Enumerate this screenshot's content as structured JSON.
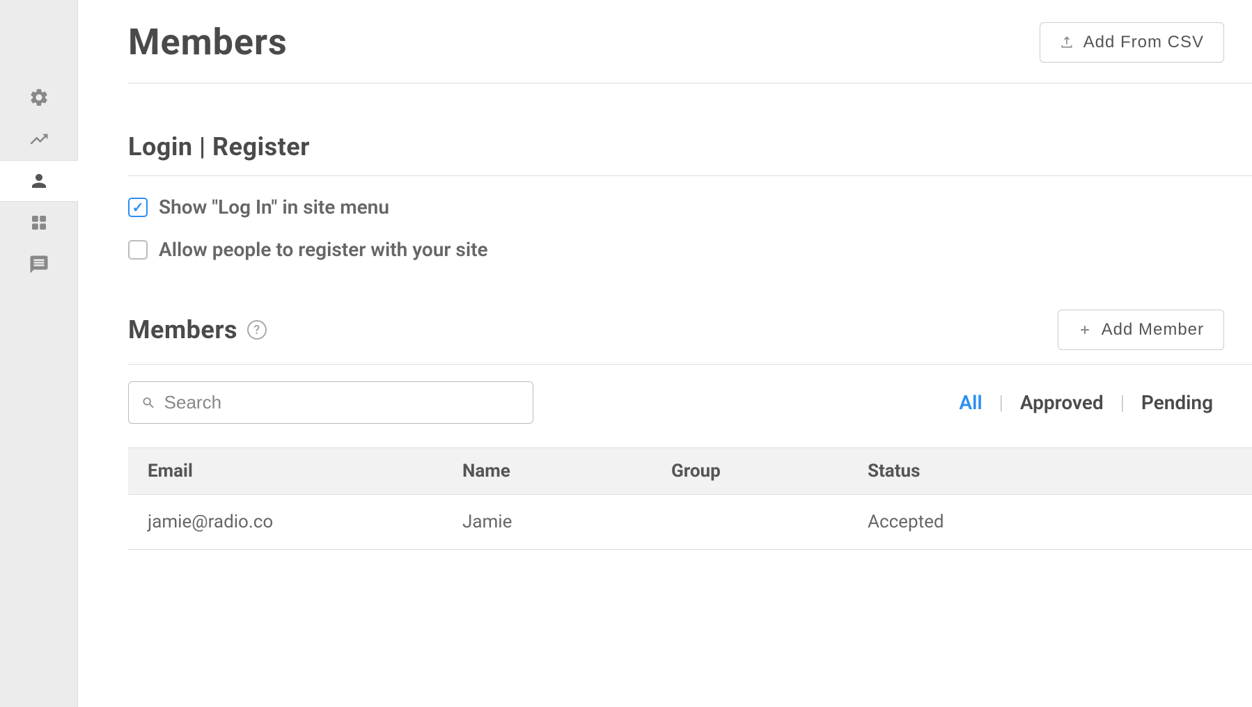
{
  "header": {
    "title": "Members",
    "add_csv_label": "Add From CSV"
  },
  "login_section": {
    "title": "Login | Register",
    "show_login_label": "Show \"Log In\" in site menu",
    "show_login_checked": true,
    "allow_register_label": "Allow people to register with your site",
    "allow_register_checked": false
  },
  "members_section": {
    "title": "Members",
    "add_member_label": "Add Member",
    "search_placeholder": "Search",
    "filters": {
      "all": "All",
      "approved": "Approved",
      "pending": "Pending"
    },
    "columns": {
      "email": "Email",
      "name": "Name",
      "group": "Group",
      "status": "Status"
    },
    "rows": [
      {
        "email": "jamie@radio.co",
        "name": "Jamie",
        "group": "",
        "status": "Accepted"
      }
    ]
  }
}
